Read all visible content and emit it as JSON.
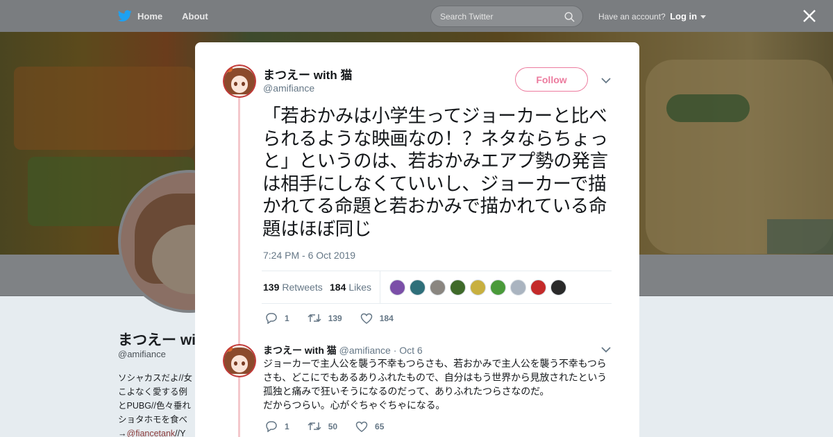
{
  "nav": {
    "home_label": "Home",
    "about_label": "About",
    "search_placeholder": "Search Twitter",
    "account_prompt": "Have an account?",
    "login_label": "Log in"
  },
  "background_profile": {
    "name": "まつえー with 猫",
    "handle": "@amifiance",
    "bio_lines": [
      "ソシャカスだよ//女",
      "こよなく愛する例",
      "とPUBG//色々垂れ",
      "ショタホモを食べ"
    ],
    "bio_link_prefix": "→",
    "bio_link": "@fiancetank",
    "bio_link_suffix": "//Y"
  },
  "tweet": {
    "author_name": "まつえー with 猫",
    "author_handle": "@amifiance",
    "follow_label": "Follow",
    "text": "「若おかみは小学生ってジョーカーと比べられるような映画なの！？ネタならちょっと」というのは、若おかみエアプ勢の発言は相手にしなくていいし、ジョーカーで描かれてる命題と若おかみで描かれている命題はほぼ同じ",
    "timestamp": "7:24 PM - 6 Oct 2019",
    "retweet_count": "139",
    "retweet_label": "Retweets",
    "like_count": "184",
    "like_label": "Likes",
    "liker_avatar_colors": [
      "#7b4fa8",
      "#2f6f7a",
      "#8a8680",
      "#3f6a2a",
      "#c8b040",
      "#4a9a3a",
      "#aab4c0",
      "#c42a2a",
      "#2a2a2a"
    ],
    "actions": {
      "replies": "1",
      "retweets": "139",
      "likes": "184"
    }
  },
  "reply": {
    "author_name": "まつえー with 猫",
    "author_handle": "@amifiance",
    "date": "· Oct 6",
    "text": "ジョーカーで主人公を襲う不幸もつらさも、若おかみで主人公を襲う不幸もつらさも、どこにでもあるありふれたもので、自分はもう世界から見放されたという孤独と痛みで狂いそうになるのだって、ありふれたつらさなのだ。\nだからつらい。心がぐちゃぐちゃになる。",
    "actions": {
      "replies": "1",
      "retweets": "50",
      "likes": "65"
    }
  },
  "colors": {
    "accent": "#e0245e",
    "thread_line": "#f4c8cc",
    "muted_text": "#657786"
  }
}
